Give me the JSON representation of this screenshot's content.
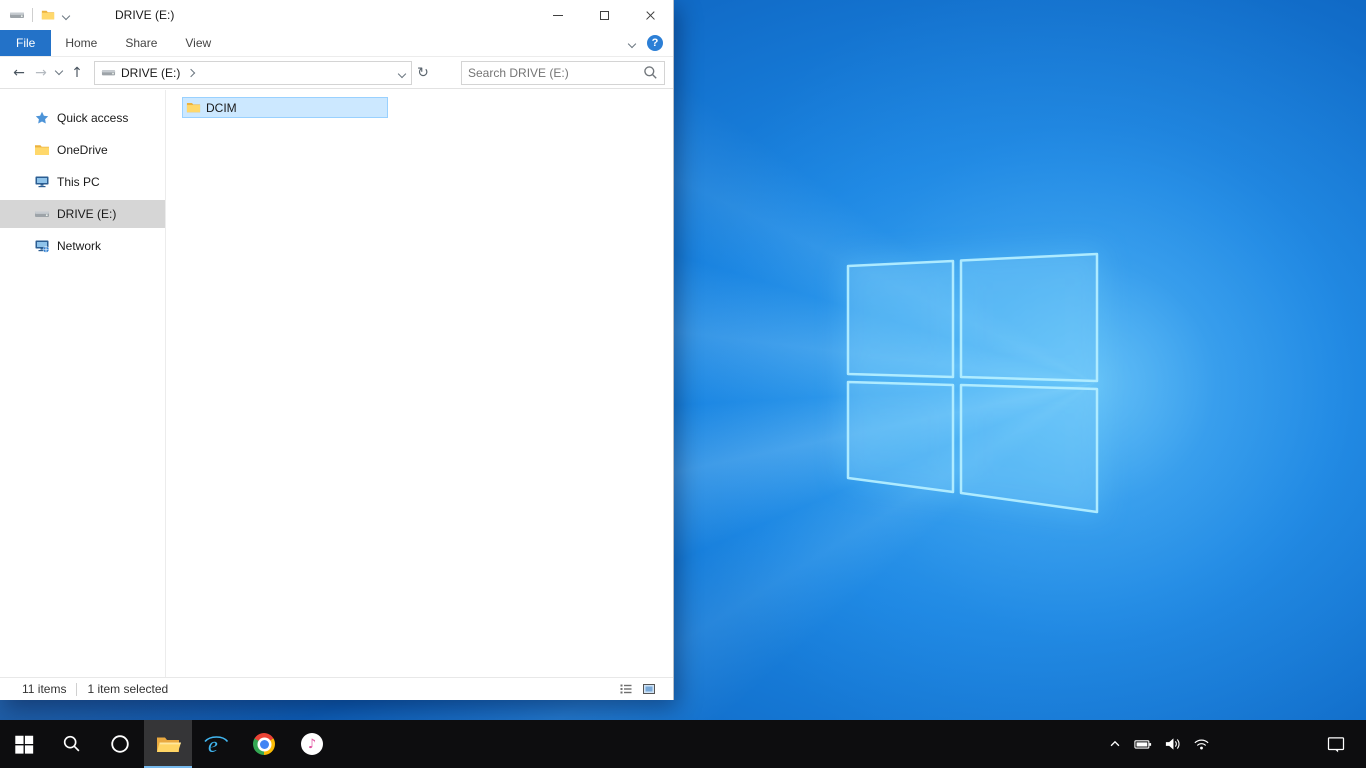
{
  "explorer": {
    "title": "DRIVE (E:)",
    "tabs": {
      "file": "File",
      "home": "Home",
      "share": "Share",
      "view": "View",
      "help": "?"
    },
    "nav": {
      "back": "←",
      "forward": "→",
      "up": "↑",
      "refresh": "↻",
      "breadcrumb_root": "DRIVE (E:)",
      "search_placeholder": "Search DRIVE (E:)"
    },
    "sidebar": {
      "items": [
        {
          "label": "Quick access",
          "icon": "star-icon"
        },
        {
          "label": "OneDrive",
          "icon": "onedrive-folder-icon"
        },
        {
          "label": "This PC",
          "icon": "computer-icon"
        },
        {
          "label": "DRIVE (E:)",
          "icon": "drive-icon",
          "selected": true
        },
        {
          "label": "Network",
          "icon": "network-icon"
        }
      ]
    },
    "content": {
      "items": [
        {
          "name": "DCIM",
          "icon": "folder-icon",
          "selected": true
        }
      ]
    },
    "statusbar": {
      "item_count": "11 items",
      "selection": "1 item selected"
    }
  },
  "taskbar": {
    "ie_glyph": "e",
    "itunes_glyph": "♪",
    "buttons": [
      "start",
      "search",
      "cortana",
      "file-explorer",
      "internet-explorer",
      "chrome",
      "itunes"
    ],
    "tray_icons": [
      "chevron-up",
      "battery",
      "speaker",
      "wifi",
      "action-center"
    ],
    "active_button": "file-explorer"
  },
  "colors": {
    "accent": "#0078d7",
    "file_tab_blue": "#2372c8",
    "selection_fill": "#cce8ff",
    "selection_border": "#99d1ff",
    "sidebar_selected": "#d6d6d6",
    "taskbar_bg": "#0d0d0f",
    "wallpaper_deep": "#094a99",
    "wallpaper_bright": "#35a3f2",
    "taskbar_active_underline": "#76b9ed"
  }
}
